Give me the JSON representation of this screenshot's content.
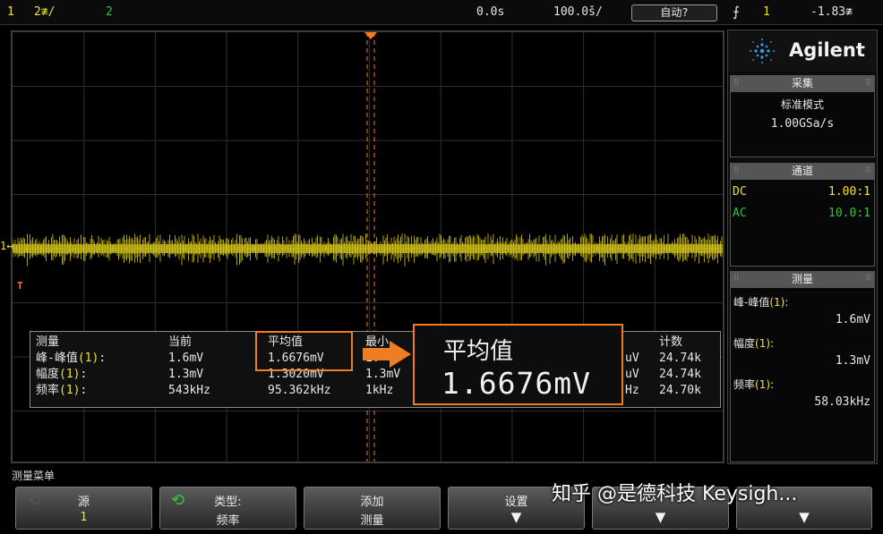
{
  "status_bar": {
    "ch1_number": "1",
    "ch1_scale": "2≇/",
    "ch2_number": "2",
    "time_offset": "0.0s",
    "time_scale": "100.0š/",
    "trigger_mode": "自动?",
    "trigger_icon": "⨍",
    "trigger_source": "1",
    "trigger_level": "-1.83≇"
  },
  "screen": {
    "ch1_marker": "1↤",
    "trigger_marker": "T",
    "trace_color": "#e6d619",
    "grid_color": "#2e2e2e",
    "cursor_color": "#f07d22"
  },
  "measurements": {
    "headers": [
      "测量",
      "当前",
      "平均值",
      "最小",
      "",
      "计数"
    ],
    "rows": [
      {
        "name": "峰-峰值",
        "index": "(1)",
        "current": "1.6mV",
        "mean": "1.6676mV",
        "min": "1.",
        "max": "uV",
        "count": "24.74k"
      },
      {
        "name": "幅度",
        "index": "(1)",
        "current": "1.3mV",
        "mean": "1.3020mV",
        "min": "1.3mV",
        "max": "uV",
        "count": "24.74k"
      },
      {
        "name": "频率",
        "index": "(1)",
        "current": "543kHz",
        "mean": "95.362kHz",
        "min": "1kHz",
        "max": "Hz",
        "count": "24.70k"
      }
    ]
  },
  "zoom_callout": {
    "title": "平均值",
    "value": "1.6676mV",
    "highlight_color": "#f07d22"
  },
  "right_panel": {
    "logo": "Agilent",
    "acquire": {
      "header": "采集",
      "mode": "标准模式",
      "rate": "1.00GSa/s"
    },
    "channels": {
      "header": "通道",
      "ch1_coupling": "DC",
      "ch1_probe": "1.00:1",
      "ch2_coupling": "AC",
      "ch2_probe": "10.0:1"
    },
    "measure": {
      "header": "测量",
      "items": [
        {
          "label": "峰-峰值",
          "index": "(1)",
          "value": "1.6mV"
        },
        {
          "label": "幅度",
          "index": "(1)",
          "value": "1.3mV"
        },
        {
          "label": "频率",
          "index": "(1)",
          "value": "58.03kHz"
        }
      ]
    }
  },
  "menu": {
    "title": "测量菜单",
    "softkeys": [
      {
        "line1": "源",
        "line2": "1"
      },
      {
        "line1": "类型:",
        "line2": "频率"
      },
      {
        "line1": "添加",
        "line2": "测量"
      },
      {
        "line1": "设置",
        "line2": ""
      },
      {
        "line1": "",
        "line2": ""
      },
      {
        "line1": "",
        "line2": ""
      }
    ]
  },
  "watermark": "知乎 @是德科技 Keysigh..."
}
